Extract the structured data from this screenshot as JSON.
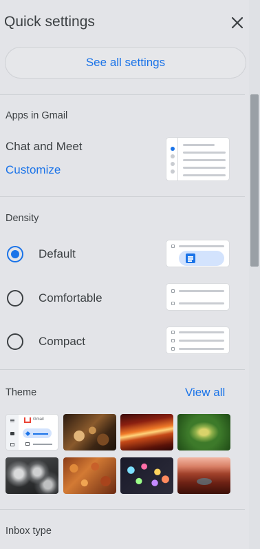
{
  "header": {
    "title": "Quick settings",
    "close_icon": "close-icon"
  },
  "see_all": {
    "label": "See all settings"
  },
  "apps": {
    "heading": "Apps in Gmail",
    "item": "Chat and Meet",
    "customize": "Customize"
  },
  "density": {
    "heading": "Density",
    "options": [
      {
        "label": "Default",
        "selected": true
      },
      {
        "label": "Comfortable",
        "selected": false
      },
      {
        "label": "Compact",
        "selected": false
      }
    ]
  },
  "theme": {
    "heading": "Theme",
    "view_all": "View all",
    "thumb_gmail_label": "Gmail",
    "tiles": [
      "default-theme",
      "chess-theme",
      "canyon-theme",
      "plant-theme",
      "bubbles-theme",
      "leaves-theme",
      "lights-theme",
      "river-canyon-theme"
    ]
  },
  "inbox": {
    "heading": "Inbox type"
  },
  "colors": {
    "accent": "#1a73e8",
    "panel": "#e3e4e8"
  }
}
